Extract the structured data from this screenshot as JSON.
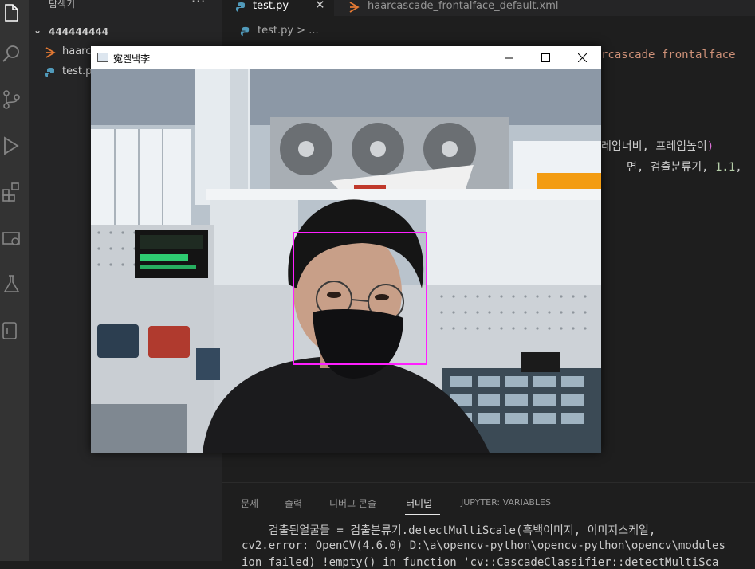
{
  "explorer": {
    "title": "탐색기",
    "more": "···",
    "folder": "444444444",
    "files": [
      {
        "name": "haarc",
        "icon": "xml-file-icon"
      },
      {
        "name": "test.p",
        "icon": "python-file-icon"
      }
    ]
  },
  "tabs": [
    {
      "label": "test.py",
      "icon": "python-file-icon",
      "active": true,
      "close": "✕"
    },
    {
      "label": "haarcascade_frontalface_default.xml",
      "icon": "xml-file-icon",
      "active": false
    }
  ],
  "breadcrumb": "test.py > ...",
  "code_peek": {
    "line1": "rcascade_frontalface_",
    "line2_pre": "레임너비, 프레임높이",
    "line2_brace": ")",
    "line3_pre": "면, 검출분류기, ",
    "line3_num": "1.1",
    "line3_post": ","
  },
  "panel": {
    "tabs": [
      "문제",
      "출력",
      "디버그 콘솔",
      "터미널",
      "JUPYTER: VARIABLES"
    ],
    "active_tab": "터미널",
    "terminal_lines": [
      "    검출된얼굴들 = 검출분류기.detectMultiScale(흑백이미지, 이미지스케일,",
      "cv2.error: OpenCV(4.6.0) D:\\a\\opencv-python\\opencv-python\\opencv\\modules",
      "ion failed) !empty() in function 'cv::CascadeClassifier::detectMultiSca"
    ]
  },
  "cv_window": {
    "title": "寃곌낵李",
    "buttons": [
      "minimize",
      "maximize",
      "close"
    ]
  },
  "colors": {
    "face_box": "#ff1fff",
    "python_icon": "#519aba",
    "xml_icon": "#e37933"
  }
}
